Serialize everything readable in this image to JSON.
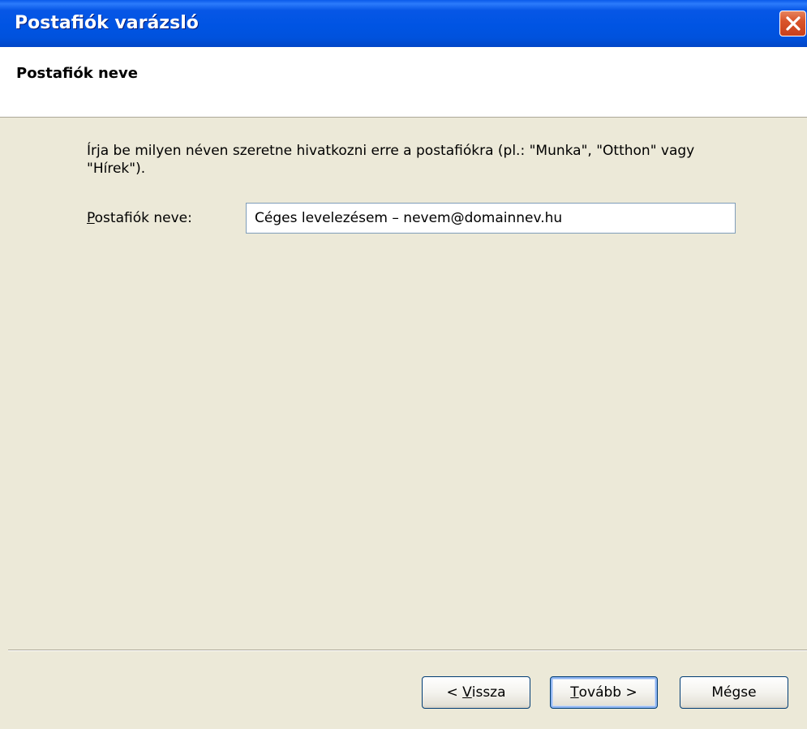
{
  "window": {
    "title": "Postafiók varázsló",
    "close_icon": "close-icon",
    "title_bar_color": "#0054E3",
    "close_button_color": "#D9542A"
  },
  "header": {
    "title": "Postafiók neve"
  },
  "body": {
    "instruction": "Írja be milyen néven szeretne hivatkozni erre a postafiókra (pl.: \"Munka\", \"Otthon\" vagy \"Hírek\").",
    "field_label_accel": "P",
    "field_label_rest": "ostafiók neve:",
    "field_value": "Céges levelezésem – nevem@domainnev.hu"
  },
  "buttons": {
    "back_prefix": "< ",
    "back_accel": "V",
    "back_rest": "issza",
    "next_accel": "T",
    "next_rest": "ovább >",
    "cancel_label": "Mégse"
  },
  "colors": {
    "dialog_bg": "#ECE9D8",
    "input_border": "#7F9DB9",
    "button_border": "#003C74"
  }
}
